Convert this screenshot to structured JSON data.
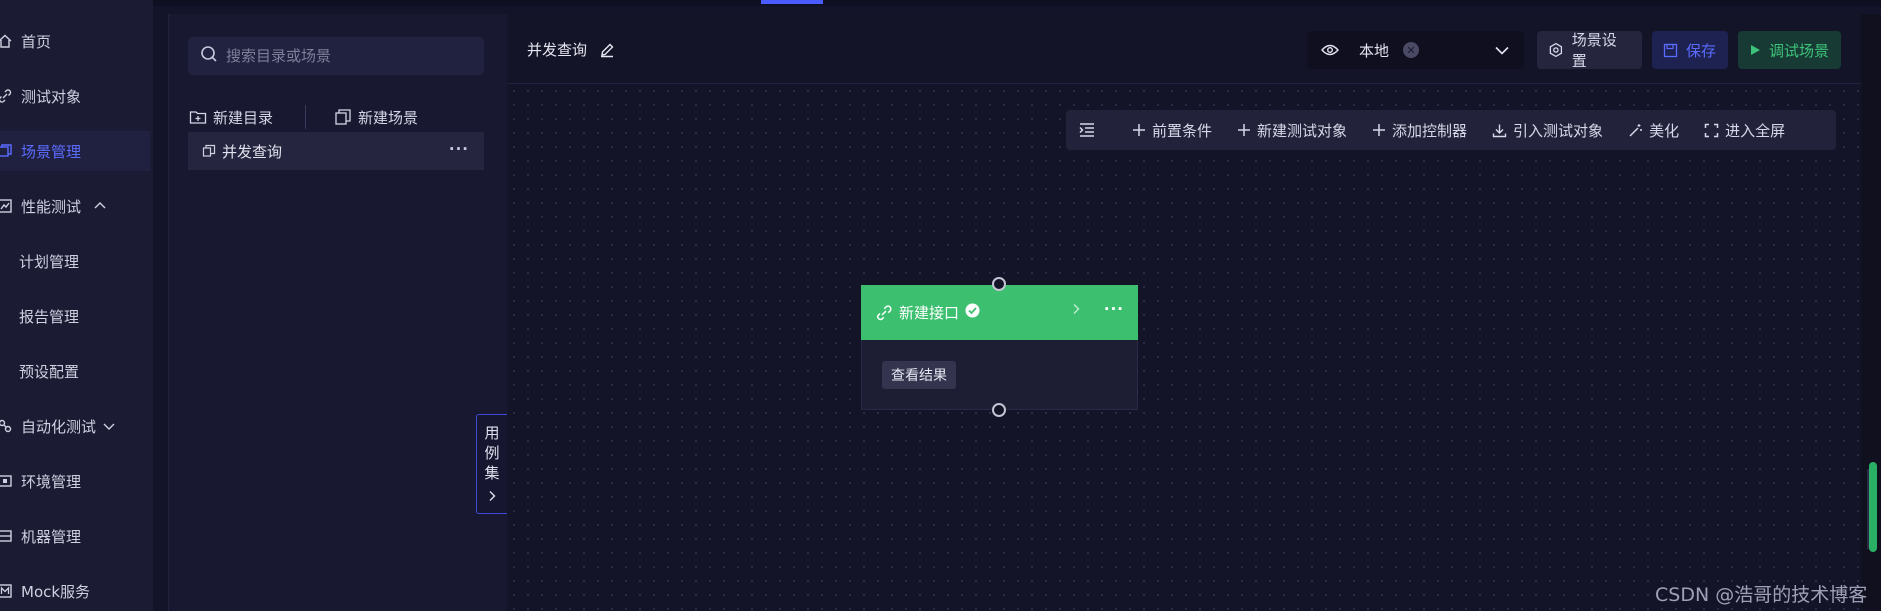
{
  "nav": {
    "items": [
      {
        "label": "首页",
        "icon": "home-icon"
      },
      {
        "label": "测试对象",
        "icon": "link-icon"
      },
      {
        "label": "场景管理",
        "icon": "scene-icon",
        "active": true
      },
      {
        "label": "性能测试",
        "icon": "chart-icon",
        "expanded": true
      },
      {
        "label": "计划管理"
      },
      {
        "label": "报告管理"
      },
      {
        "label": "预设配置"
      },
      {
        "label": "自动化测试",
        "icon": "robot-icon",
        "expanded": false
      },
      {
        "label": "环境管理",
        "icon": "env-icon"
      },
      {
        "label": "机器管理",
        "icon": "machine-icon"
      },
      {
        "label": "Mock服务",
        "icon": "mock-icon"
      }
    ]
  },
  "tree": {
    "search_placeholder": "搜索目录或场景",
    "new_folder": "新建目录",
    "new_scene": "新建场景",
    "items": [
      {
        "label": "并发查询"
      }
    ]
  },
  "header": {
    "scene_title": "并发查询",
    "env_value": "本地",
    "scene_settings": "场景设置",
    "save": "保存",
    "debug": "调试场景"
  },
  "toolbar": {
    "precondition": "前置条件",
    "new_test_object": "新建测试对象",
    "add_controller": "添加控制器",
    "import_test_object": "引入测试对象",
    "beautify": "美化",
    "fullscreen": "进入全屏"
  },
  "node": {
    "title": "新建接口",
    "view_result": "查看结果"
  },
  "case_tab": {
    "c1": "用",
    "c2": "例",
    "c3": "集"
  },
  "watermark": "CSDN @浩哥的技术博客",
  "colors": {
    "accent": "#5b6cff",
    "success": "#3cc070",
    "background": "#13132a"
  }
}
